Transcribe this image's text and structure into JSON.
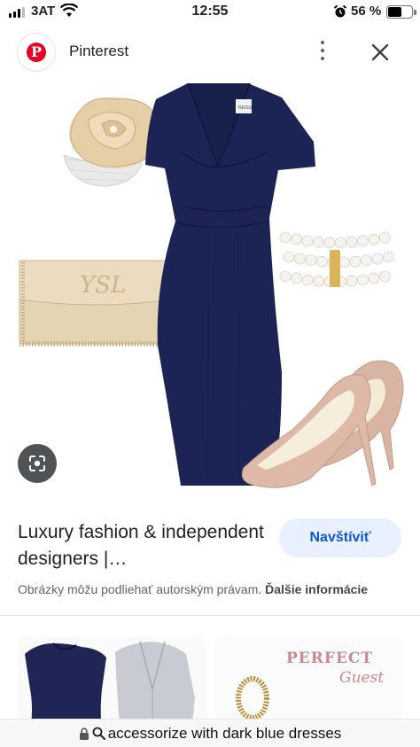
{
  "status_bar": {
    "carrier": "3AT",
    "time": "12:55",
    "battery_percent": "56 %",
    "battery_level": 0.56,
    "icons": [
      "signal-icon",
      "wifi-icon",
      "alarm-icon",
      "battery-icon"
    ]
  },
  "header": {
    "site_name": "Pinterest",
    "logo_letter": "P",
    "brand_color": "#e60023",
    "icons": [
      "pinterest-logo-icon",
      "more-vert-icon",
      "close-icon"
    ]
  },
  "main_image": {
    "label_tag": "REISS",
    "lens_icon": "google-lens-icon"
  },
  "result": {
    "title": "Luxury fashion & independent designers |…",
    "visit_label": "Navštíviť",
    "copyright_notice": "Obrázky môžu podliehať autorským právam.",
    "more_info_label": "Ďalšie informácie"
  },
  "related": {
    "card2_heading": "PERFECT",
    "card2_script": "Guest"
  },
  "url_bar": {
    "text": "accessorize with dark blue dresses",
    "icons": [
      "lock-icon",
      "search-icon"
    ]
  },
  "colors": {
    "accent": "#0b57d0",
    "button_bg": "#e8f0fe",
    "dress_navy": "#1c2456"
  }
}
